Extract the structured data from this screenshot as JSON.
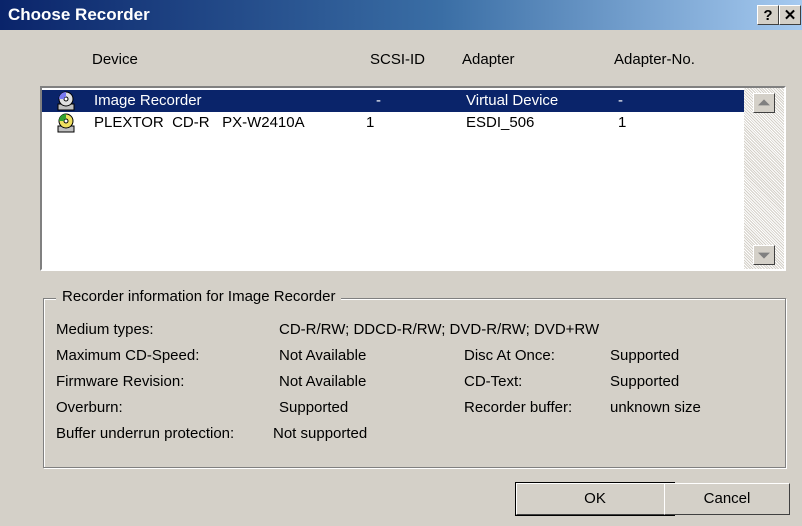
{
  "window": {
    "title": "Choose Recorder",
    "help_glyph": "?",
    "close_glyph": "✕"
  },
  "columns": {
    "device": "Device",
    "scsi_id": "SCSI-ID",
    "adapter": "Adapter",
    "adapter_no": "Adapter-No."
  },
  "devices": [
    {
      "name": "Image Recorder",
      "scsi_id": "-",
      "adapter": "Virtual Device",
      "adapter_no": "-",
      "selected": true
    },
    {
      "name": "PLEXTOR  CD-R   PX-W2410A",
      "scsi_id": "1",
      "adapter": "ESDI_506",
      "adapter_no": "1",
      "selected": false
    }
  ],
  "info": {
    "legend": "Recorder information for Image Recorder",
    "medium_types_label": "Medium types:",
    "medium_types_value": "CD-R/RW; DDCD-R/RW; DVD-R/RW; DVD+RW",
    "max_speed_label": "Maximum CD-Speed:",
    "max_speed_value": "Not Available",
    "firmware_label": "Firmware Revision:",
    "firmware_value": "Not Available",
    "overburn_label": "Overburn:",
    "overburn_value": "Supported",
    "buffer_underrun_label": "Buffer underrun protection:",
    "buffer_underrun_value": "Not supported",
    "dao_label": "Disc At Once:",
    "dao_value": "Supported",
    "cdtext_label": "CD-Text:",
    "cdtext_value": "Supported",
    "buffer_label": "Recorder buffer:",
    "buffer_value": "unknown size"
  },
  "buttons": {
    "ok": "OK",
    "cancel": "Cancel"
  },
  "colors": {
    "selection": "#0a246a",
    "face": "#d4d0c8",
    "title_start": "#0a246a",
    "title_end": "#a6caf0"
  }
}
